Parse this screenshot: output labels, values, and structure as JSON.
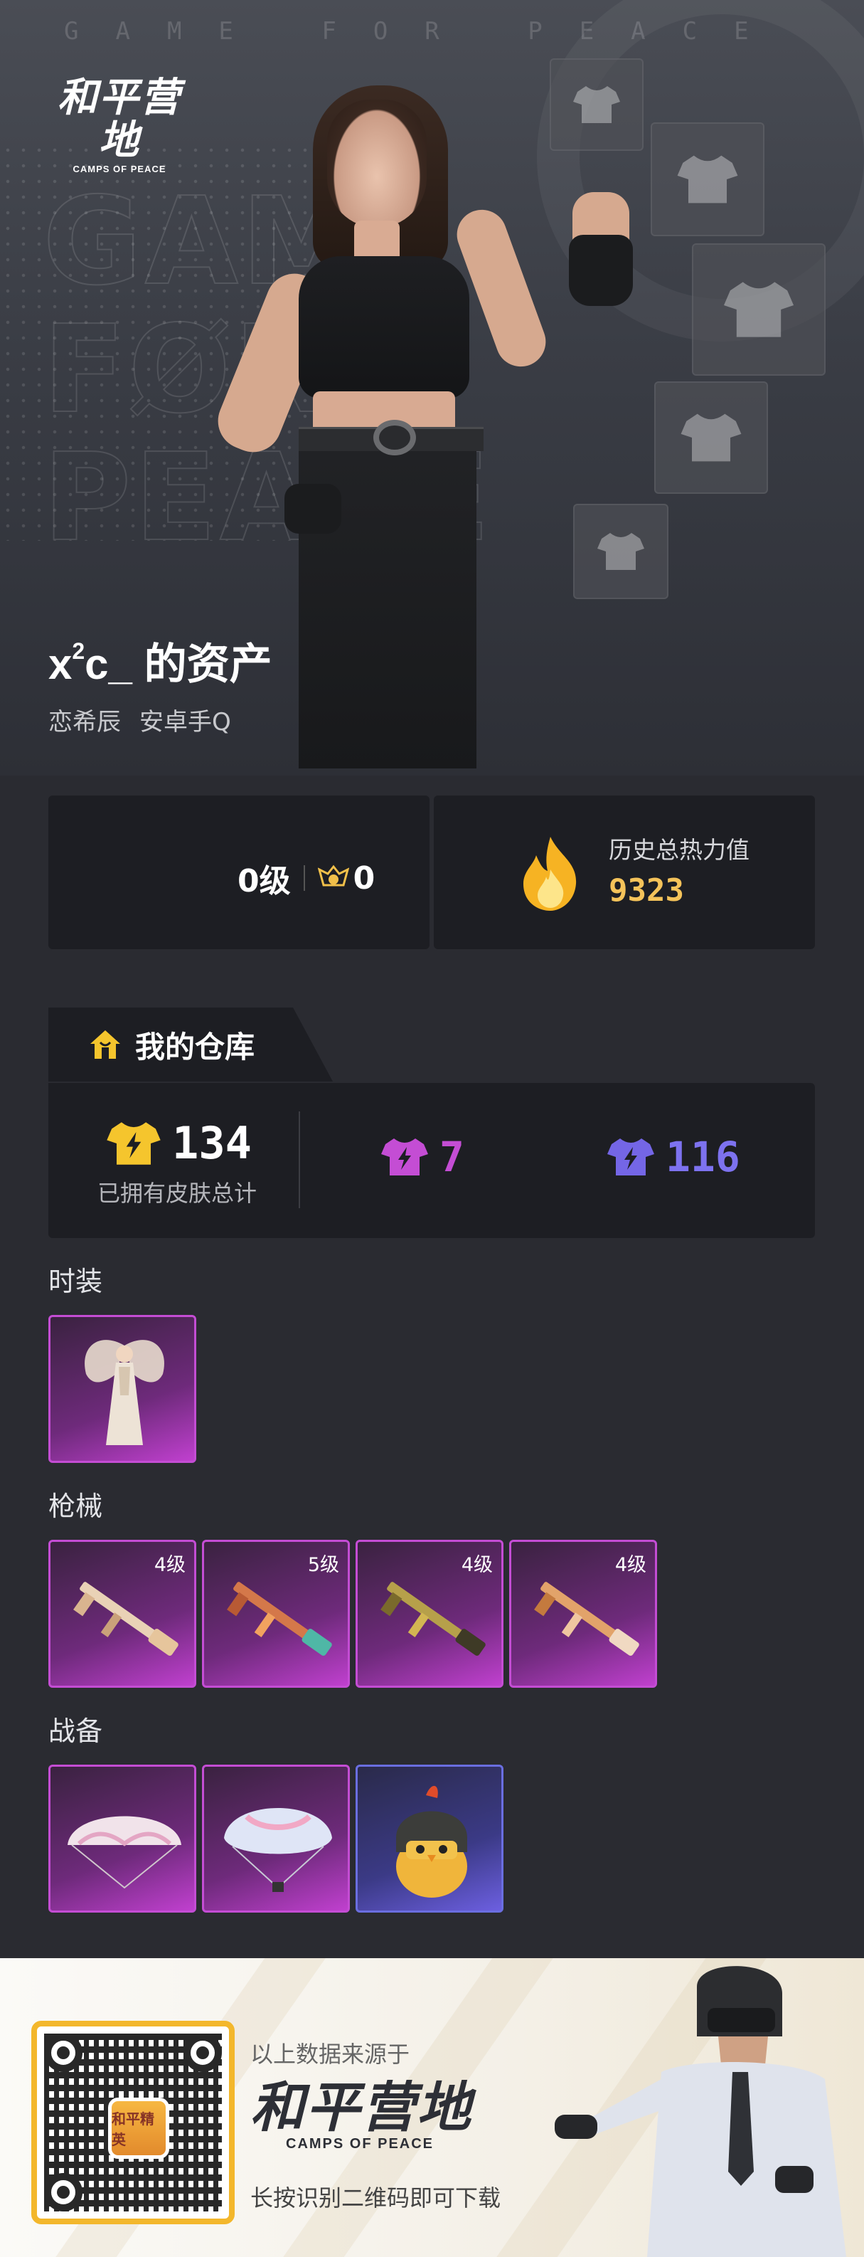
{
  "header": {
    "banner_text": "GAME FOR PEACE",
    "logo_cn": "和平营地",
    "logo_en": "CAMPS OF PEACE",
    "bg_word": "GAME FOR PEACE"
  },
  "owner": {
    "name_base": "x",
    "name_sup": "2",
    "name_rest": "c_ 的资产",
    "nickname": "恋希辰",
    "platform": "安卓手Q"
  },
  "stats": {
    "level": "0级",
    "badge_count": "0",
    "heat_label": "历史总热力值",
    "heat_value": "9323"
  },
  "warehouse": {
    "title": "我的仓库",
    "total_count": "134",
    "total_label": "已拥有皮肤总计",
    "purple_count": "7",
    "blue_count": "116",
    "colors": {
      "gold": "#f5c52d",
      "purple": "#c44dd4",
      "blue": "#7466e6"
    }
  },
  "sections": {
    "outfits": {
      "title": "时装",
      "items": [
        {
          "name": "angel-outfit-item"
        }
      ]
    },
    "guns": {
      "title": "枪械",
      "items": [
        {
          "level": "4级"
        },
        {
          "level": "5级"
        },
        {
          "level": "4级"
        },
        {
          "level": "4级"
        }
      ]
    },
    "gear": {
      "title": "战备",
      "items": [
        {
          "name": "pink-parachute"
        },
        {
          "name": "blue-parachute"
        },
        {
          "name": "chicken-helmet"
        }
      ]
    }
  },
  "footer": {
    "source_text": "以上数据来源于",
    "logo_cn": "和平营地",
    "logo_en": "CAMPS OF PEACE",
    "scan_text": "长按识别二维码即可下载",
    "qr_logo_text": "和平精英"
  }
}
